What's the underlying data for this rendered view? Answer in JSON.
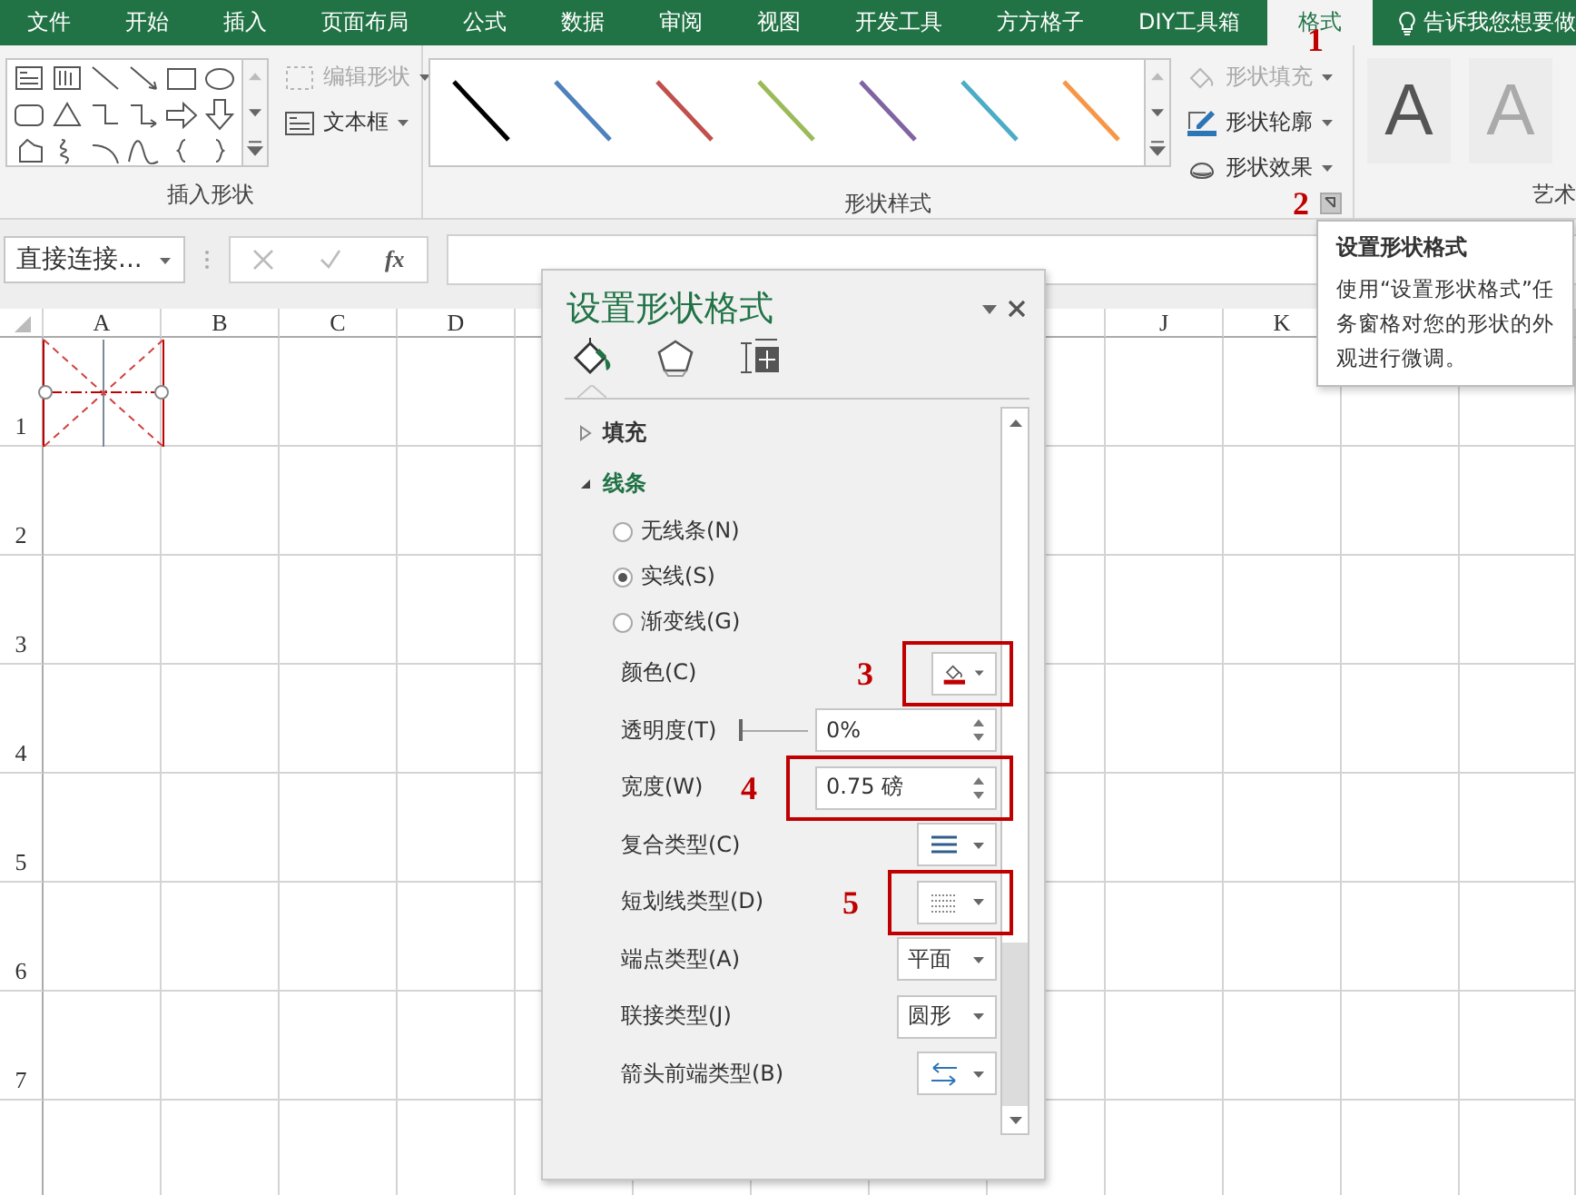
{
  "tabs": [
    {
      "label": "文件",
      "selected": false
    },
    {
      "label": "开始",
      "selected": false
    },
    {
      "label": "插入",
      "selected": false
    },
    {
      "label": "页面布局",
      "selected": false
    },
    {
      "label": "公式",
      "selected": false
    },
    {
      "label": "数据",
      "selected": false
    },
    {
      "label": "审阅",
      "selected": false
    },
    {
      "label": "视图",
      "selected": false
    },
    {
      "label": "开发工具",
      "selected": false
    },
    {
      "label": "方方格子",
      "selected": false
    },
    {
      "label": "DIY工具箱",
      "selected": false
    },
    {
      "label": "格式",
      "selected": true,
      "callout": "1"
    }
  ],
  "tell_me": {
    "text": "告诉我您想要做"
  },
  "ribbon": {
    "insert_shapes": {
      "label": "插入形状",
      "buttons": [
        {
          "label": "编辑形状",
          "kind": "edit",
          "disabled": true
        },
        {
          "label": "文本框",
          "kind": "textbox",
          "disabled": false
        }
      ]
    },
    "shape_styles": {
      "label": "形状样式",
      "launcher_callout": "2",
      "styles": [
        {
          "color": "#000000"
        },
        {
          "color": "#4f81bd"
        },
        {
          "color": "#c0504d"
        },
        {
          "color": "#9bbb59"
        },
        {
          "color": "#8064a2"
        },
        {
          "color": "#4bacc6"
        },
        {
          "color": "#f79646"
        }
      ],
      "buttons": [
        {
          "label": "形状填充",
          "kind": "fill",
          "disabled": true
        },
        {
          "label": "形状轮廓",
          "kind": "outline",
          "disabled": false
        },
        {
          "label": "形状效果",
          "kind": "effects",
          "disabled": false
        }
      ]
    },
    "wordart": {
      "label": "艺术",
      "samples": [
        {
          "text": "A",
          "kind": "dark"
        },
        {
          "text": "A",
          "kind": "light"
        }
      ]
    }
  },
  "formula_bar": {
    "name_box": "直接连接...",
    "function_label": "fx"
  },
  "sheet": {
    "columns": [
      "A",
      "B",
      "C",
      "D",
      "J",
      "K"
    ],
    "rows": [
      "1",
      "2",
      "3",
      "4",
      "5",
      "6",
      "7"
    ]
  },
  "pane": {
    "title": "设置形状格式",
    "tabs": [
      {
        "kind": "fill",
        "selected": true
      },
      {
        "kind": "effects",
        "selected": false
      },
      {
        "kind": "size",
        "selected": false
      }
    ],
    "sections": [
      {
        "label": "填充",
        "expanded": false
      },
      {
        "label": "线条",
        "expanded": true
      }
    ],
    "line_options": [
      {
        "label": "无线条(N)",
        "selected": false
      },
      {
        "label": "实线(S)",
        "selected": true
      },
      {
        "label": "渐变线(G)",
        "selected": false
      }
    ],
    "properties": [
      {
        "kind": "color",
        "label": "颜色(C)",
        "color": "#c00000",
        "callout": "3",
        "highlighted": true
      },
      {
        "kind": "slider",
        "label": "透明度(T)",
        "value": "0%",
        "level": 0,
        "highlighted": false
      },
      {
        "kind": "spin",
        "label": "宽度(W)",
        "value": "0.75 磅",
        "callout": "4",
        "highlighted": true
      },
      {
        "kind": "compound",
        "label": "复合类型(C)",
        "highlighted": false
      },
      {
        "kind": "dash",
        "label": "短划线类型(D)",
        "callout": "5",
        "highlighted": true
      },
      {
        "kind": "select",
        "label": "端点类型(A)",
        "value": "平面",
        "highlighted": false
      },
      {
        "kind": "select",
        "label": "联接类型(J)",
        "value": "圆形",
        "highlighted": false
      },
      {
        "kind": "arrow",
        "label": "箭头前端类型(B)",
        "highlighted": false
      }
    ]
  },
  "tooltip": {
    "title": "设置形状格式",
    "text": "使用“设置形状格式”任务窗格对您的形状的外观进行微调。"
  }
}
